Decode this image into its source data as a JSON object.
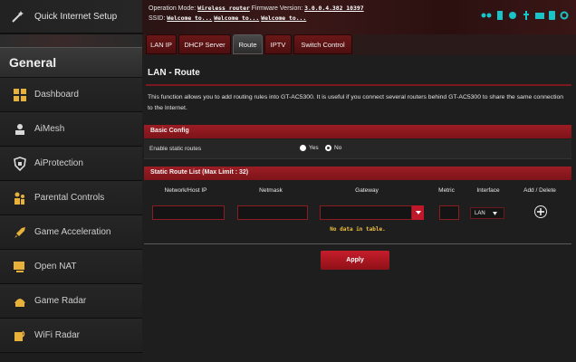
{
  "colors": {
    "accent": "#9c1d24",
    "sidebar_bg": "#1d1d1d",
    "content_bg": "#1e1e1e",
    "no_data_text": "#f2c040"
  },
  "sidebar": {
    "quick_setup": {
      "label": "Quick Internet Setup",
      "icon": "wand-icon"
    },
    "section_title": "General",
    "items": [
      {
        "label": "Dashboard",
        "icon": "dashboard-icon"
      },
      {
        "label": "AiMesh",
        "icon": "mesh-icon"
      },
      {
        "label": "AiProtection",
        "icon": "shield-icon"
      },
      {
        "label": "Parental Controls",
        "icon": "family-icon"
      },
      {
        "label": "Game Acceleration",
        "icon": "rocket-icon"
      },
      {
        "label": "Open NAT",
        "icon": "nat-icon"
      },
      {
        "label": "Game Radar",
        "icon": "game-radar-icon"
      },
      {
        "label": "WiFi Radar",
        "icon": "wifi-radar-icon"
      }
    ]
  },
  "header": {
    "operation_mode_label": "Operation Mode:",
    "operation_mode_value": "Wireless router",
    "firmware_label": "Firmware Version:",
    "firmware_value": "3.0.0.4.382_10397",
    "ssid_label": "SSID:",
    "ssid_values": [
      "Welcome to...",
      "Welcome to...",
      "Welcome to..."
    ]
  },
  "tabs": [
    {
      "label": "LAN IP"
    },
    {
      "label": "DHCP Server"
    },
    {
      "label": "Route",
      "active": true
    },
    {
      "label": "IPTV"
    },
    {
      "label": "Switch Control"
    }
  ],
  "main": {
    "title": "LAN - Route",
    "description": "This function allows you to add routing rules into GT-AC5300. It is useful if you connect several routers behind GT-AC5300 to share the same connection to the Internet.",
    "basic_config": {
      "header": "Basic Config",
      "enable_static_label": "Enable static routes",
      "options": [
        "Yes",
        "No"
      ],
      "selected": "No"
    },
    "static_list": {
      "header": "Static Route List (Max Limit : 32)",
      "columns": [
        "Network/Host IP",
        "Netmask",
        "Gateway",
        "Metric",
        "Interface",
        "Add / Delete"
      ],
      "interface_value": "LAN",
      "empty_message": "No data in table."
    },
    "apply_label": "Apply"
  }
}
